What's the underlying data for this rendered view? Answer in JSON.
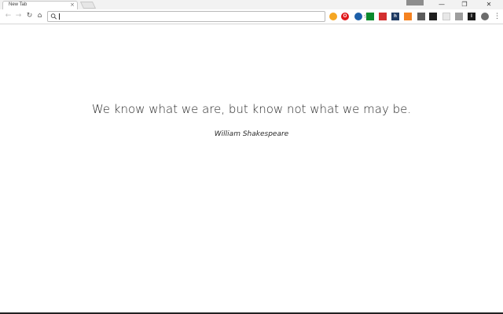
{
  "browser": {
    "tab": {
      "title": "New Tab",
      "close_glyph": "×"
    },
    "window_controls": {
      "minimize": "—",
      "restore": "❐",
      "close": "✕"
    },
    "nav": {
      "back": "←",
      "forward": "→",
      "reload": "↻",
      "home": "⌂"
    },
    "omnibox": {
      "value": "",
      "placeholder": "",
      "bookmark_glyph": "☆"
    },
    "extensions": [
      {
        "icon": "orange-circle-extension-icon",
        "color": "#f5a623",
        "glyph": ""
      },
      {
        "icon": "opera-red-extension-icon",
        "color": "#e0191b",
        "glyph": "O"
      },
      {
        "icon": "blue-globe-extension-icon",
        "color": "#1d5fa8",
        "glyph": ""
      },
      {
        "icon": "green-square-extension-icon",
        "color": "#0b8a2c",
        "glyph": ""
      },
      {
        "icon": "red-lobster-extension-icon",
        "color": "#d32f2f",
        "glyph": ""
      },
      {
        "icon": "h-extension-icon",
        "color": "#1f3b63",
        "glyph": "h"
      },
      {
        "icon": "rss-extension-icon",
        "color": "#f58220",
        "glyph": ""
      },
      {
        "icon": "pocket-extension-icon",
        "color": "#5c5c5c",
        "glyph": ""
      },
      {
        "icon": "stack-extension-icon",
        "color": "#202020",
        "glyph": ""
      },
      {
        "icon": "blank-extension-icon",
        "color": "#e8e8e8",
        "glyph": ""
      },
      {
        "icon": "checkbox-extension-icon",
        "color": "#9e9e9e",
        "glyph": ""
      },
      {
        "icon": "instapaper-extension-icon",
        "color": "#1a1a1a",
        "glyph": "I"
      },
      {
        "icon": "gear-extension-icon",
        "color": "#6d6d6d",
        "glyph": ""
      },
      {
        "icon": "orange-x-extension-icon",
        "color": "#f26522",
        "glyph": ""
      }
    ],
    "menu_glyph": "⋮"
  },
  "page": {
    "quote": "We know what we are, but know not what we may be.",
    "author": "William Shakespeare"
  },
  "colors": {
    "text": "#2b2b2b",
    "background": "#ffffff"
  }
}
